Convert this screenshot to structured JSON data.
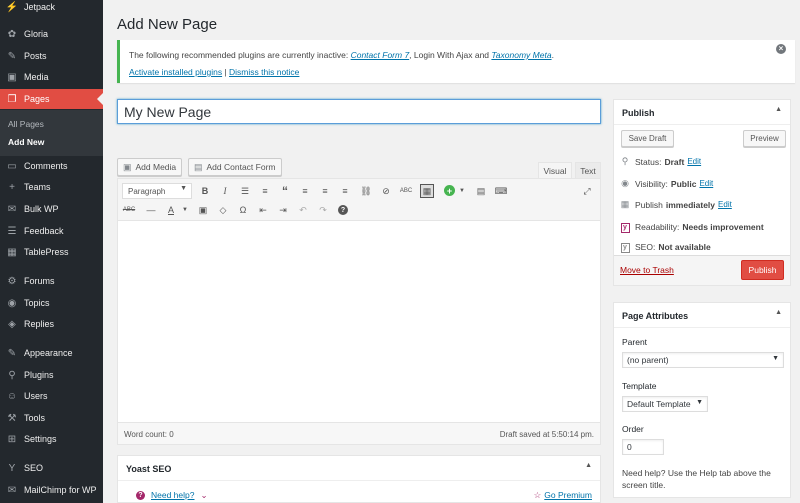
{
  "sidebar": {
    "items": [
      {
        "label": "Jetpack",
        "icon": "jetpack-icon",
        "glyph": "⚡"
      },
      {
        "label": "Gloria",
        "icon": "gloria-icon",
        "glyph": "✿"
      },
      {
        "label": "Posts",
        "icon": "pin-icon",
        "glyph": "📌"
      },
      {
        "label": "Media",
        "icon": "media-icon",
        "glyph": "▣"
      },
      {
        "label": "Pages",
        "icon": "pages-icon",
        "glyph": "❐"
      },
      {
        "label": "Comments",
        "icon": "comment-icon",
        "glyph": "💬"
      },
      {
        "label": "Teams",
        "icon": "plus-icon",
        "glyph": "+"
      },
      {
        "label": "Bulk WP",
        "icon": "bulk-icon",
        "glyph": "✉"
      },
      {
        "label": "Feedback",
        "icon": "feedback-icon",
        "glyph": "☰"
      },
      {
        "label": "TablePress",
        "icon": "table-icon",
        "glyph": "▦"
      },
      {
        "label": "Forums",
        "icon": "forums-icon",
        "glyph": "⚙"
      },
      {
        "label": "Topics",
        "icon": "topics-icon",
        "glyph": "◉"
      },
      {
        "label": "Replies",
        "icon": "replies-icon",
        "glyph": "◈"
      },
      {
        "label": "Appearance",
        "icon": "brush-icon",
        "glyph": "✎"
      },
      {
        "label": "Plugins",
        "icon": "plug-icon",
        "glyph": "⚲"
      },
      {
        "label": "Users",
        "icon": "users-icon",
        "glyph": "👤"
      },
      {
        "label": "Tools",
        "icon": "wrench-icon",
        "glyph": "🔧"
      },
      {
        "label": "Settings",
        "icon": "settings-icon",
        "glyph": "⊞"
      },
      {
        "label": "SEO",
        "icon": "yoast-icon",
        "glyph": "Y"
      },
      {
        "label": "MailChimp for WP",
        "icon": "mailchimp-icon",
        "glyph": "✉"
      }
    ],
    "submenu": [
      "All Pages",
      "Add New"
    ]
  },
  "header": {
    "title": "Add New Page"
  },
  "notice": {
    "text_before": "The following recommended plugins are currently inactive: ",
    "plugin1": "Contact Form 7",
    "text_mid": ", Login With Ajax and ",
    "plugin2": "Taxonomy Meta",
    "text_after": ".",
    "activate": "Activate installed plugins",
    "separator": " | ",
    "dismiss": "Dismiss this notice",
    "close_glyph": "×"
  },
  "editor": {
    "title_value": "My New Page",
    "add_media": "Add Media",
    "add_contact_form": "Add Contact Form",
    "tab_visual": "Visual",
    "tab_text": "Text",
    "format": "Paragraph",
    "word_count": "Word count: 0",
    "draft_saved": "Draft saved at 5:50:14 pm."
  },
  "yoast": {
    "title": "Yoast SEO",
    "need_help": "Need help?",
    "go_premium": "Go Premium"
  },
  "publish": {
    "title": "Publish",
    "save_draft": "Save Draft",
    "preview": "Preview",
    "status_label": "Status:",
    "status_value": "Draft",
    "visibility_label": "Visibility:",
    "visibility_value": "Public",
    "publish_label": "Publish",
    "publish_value": "immediately",
    "readability_label": "Readability:",
    "readability_value": "Needs improvement",
    "seo_label": "SEO:",
    "seo_value": "Not available",
    "edit": "Edit",
    "trash": "Move to Trash",
    "publish_button": "Publish"
  },
  "attributes": {
    "title": "Page Attributes",
    "parent_label": "Parent",
    "parent_value": "(no parent)",
    "template_label": "Template",
    "template_value": "Default Template",
    "order_label": "Order",
    "order_value": "0",
    "help": "Need help? Use the Help tab above the screen title."
  },
  "colors": {
    "accent": "#e14d43",
    "link": "#0073aa",
    "sidebar": "#23282d"
  }
}
